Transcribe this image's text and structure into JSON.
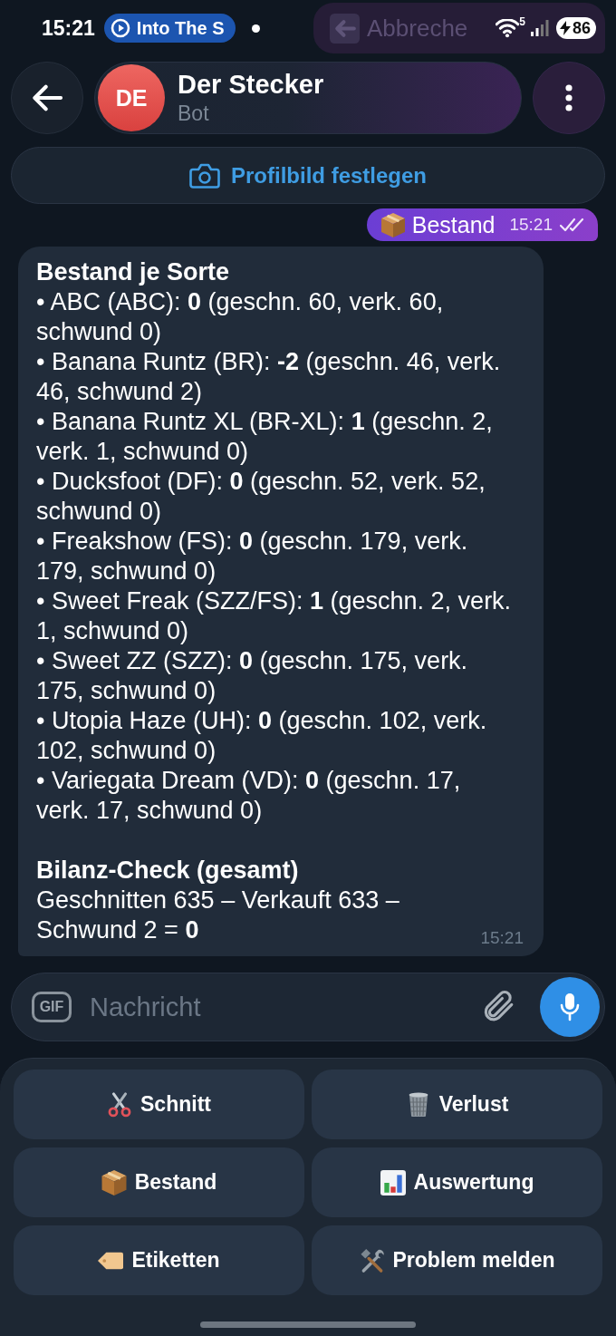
{
  "status_bar": {
    "time": "15:21",
    "media_title": "Into The S",
    "wifi_label": "5",
    "battery": "86"
  },
  "background_message": {
    "text": "Abbreche"
  },
  "header": {
    "avatar": "DE",
    "title": "Der Stecker",
    "subtitle": "Bot"
  },
  "banner": {
    "label": "Profilbild festlegen"
  },
  "outgoing_message": {
    "text": "Bestand",
    "time": "15:21",
    "read": true
  },
  "incoming_message": {
    "sections": [
      {
        "heading": "Bestand je Sorte",
        "lines": [
          "• ABC (ABC): **0** (geschn. 60, verk. 60, schwund 0)",
          "• Banana Runtz (BR): **-2** (geschn. 46, verk. 46, schwund 2)",
          "• Banana Runtz XL (BR-XL): **1** (geschn. 2, verk. 1, schwund 0)",
          "• Ducksfoot (DF): **0** (geschn. 52, verk. 52, schwund 0)",
          "• Freakshow (FS): **0** (geschn. 179, verk. 179, schwund 0)",
          "• Sweet Freak (SZZ/FS): **1** (geschn. 2, verk. 1, schwund 0)",
          "• Sweet ZZ (SZZ): **0** (geschn. 175, verk. 175, schwund 0)",
          "• Utopia Haze (UH): **0** (geschn. 102, verk. 102, schwund 0)",
          "• Variegata Dream (VD): **0** (geschn. 17, verk. 17, schwund 0)"
        ]
      },
      {
        "heading": "Bilanz-Check (gesamt)",
        "lines": [
          "Geschnitten 635 – Verkauft 633 – Schwund 2 = **0**"
        ]
      }
    ],
    "time": "15:21"
  },
  "composer": {
    "gif_label": "GIF",
    "placeholder": "Nachricht"
  },
  "keyboard": {
    "buttons": [
      {
        "label": "Schnitt",
        "kind": "cut"
      },
      {
        "label": "Verlust",
        "kind": "loss"
      },
      {
        "label": "Bestand",
        "kind": "stock"
      },
      {
        "label": "Auswertung",
        "kind": "report"
      },
      {
        "label": "Etiketten",
        "kind": "labels"
      },
      {
        "label": "Problem melden",
        "kind": "issue"
      }
    ]
  }
}
